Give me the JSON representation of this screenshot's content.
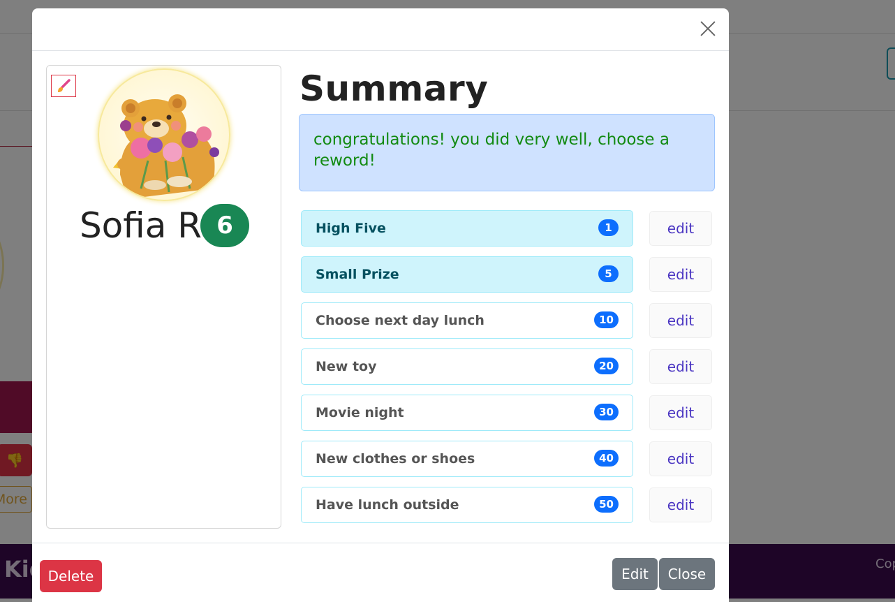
{
  "background": {
    "footer_left_text": "Kid",
    "footer_right_text": "Cop",
    "more_button_label": "More"
  },
  "modal": {
    "profile": {
      "name": "Sofia R",
      "score": "6",
      "avatar_icon": "bear-with-flowers-avatar",
      "edit_avatar_icon": "paintbrush-icon"
    },
    "summary": {
      "title": "Summary",
      "message": "congratulations! you did very well, choose a reword!"
    },
    "rewards": [
      {
        "label": "High Five",
        "points": "1",
        "active": true,
        "edit_label": "edit"
      },
      {
        "label": "Small Prize",
        "points": "5",
        "active": true,
        "edit_label": "edit"
      },
      {
        "label": "Choose next day lunch",
        "points": "10",
        "active": false,
        "edit_label": "edit"
      },
      {
        "label": "New toy",
        "points": "20",
        "active": false,
        "edit_label": "edit"
      },
      {
        "label": "Movie night",
        "points": "30",
        "active": false,
        "edit_label": "edit"
      },
      {
        "label": "New clothes or shoes",
        "points": "40",
        "active": false,
        "edit_label": "edit"
      },
      {
        "label": "Have lunch outside",
        "points": "50",
        "active": false,
        "edit_label": "edit"
      }
    ],
    "footer": {
      "delete_label": "Delete",
      "edit_label": "Edit",
      "close_label": "Close"
    }
  },
  "colors": {
    "danger": "#dc3545",
    "success": "#198754",
    "primary": "#0d6efd",
    "secondary": "#6c757d",
    "info_light": "#cff4fc",
    "alert_bg": "#cfe2ff",
    "alert_text": "#128a12"
  }
}
